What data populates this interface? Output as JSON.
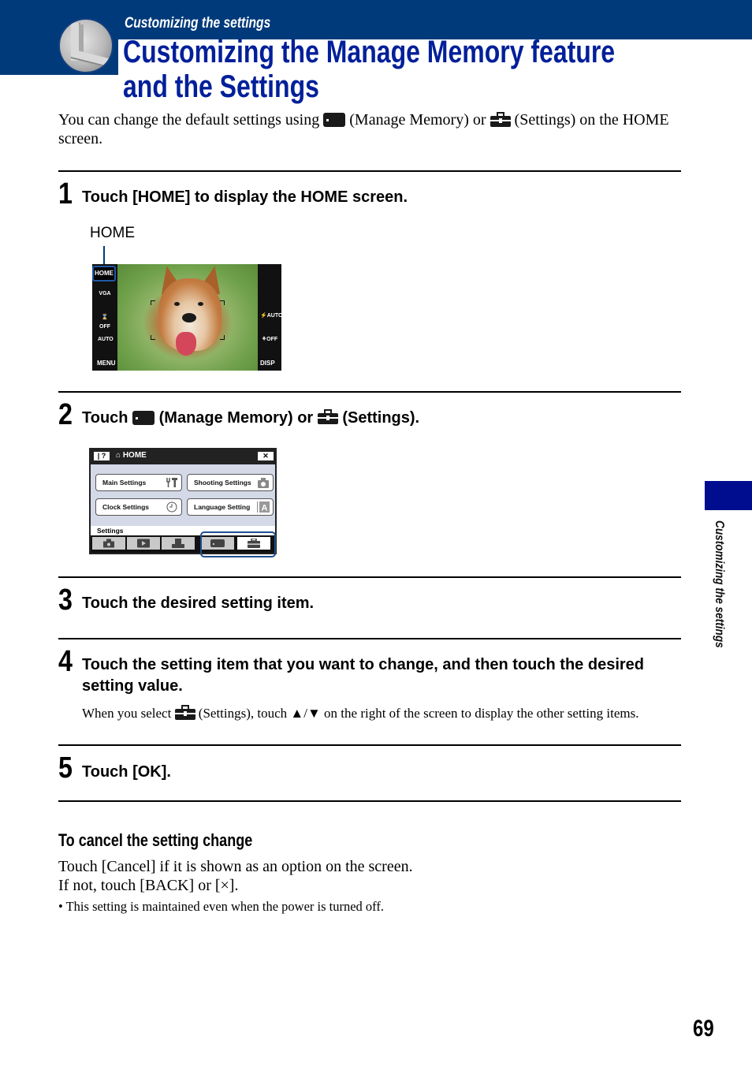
{
  "header": {
    "section_label": "Customizing the settings",
    "title_line1": "Customizing the Manage Memory feature",
    "title_line2": "and the Settings"
  },
  "intro": {
    "part1": "You can change the default settings using ",
    "manage_memory": " (Manage Memory) or ",
    "settings": " (Settings) on the HOME screen."
  },
  "steps": [
    {
      "number": "1",
      "text": "Touch [HOME] to display the HOME screen."
    },
    {
      "number": "2",
      "text_a": "Touch ",
      "text_b": " (Manage Memory) or ",
      "text_c": " (Settings)."
    },
    {
      "number": "3",
      "text": "Touch the desired setting item."
    },
    {
      "number": "4",
      "text": "Touch the setting item that you want to change, and then touch the desired setting value.",
      "note_a": "When you select ",
      "note_b": " (Settings), touch ▲/▼ on the right of the screen to display the other setting items."
    },
    {
      "number": "5",
      "text": "Touch [OK]."
    }
  ],
  "camera_screen_1": {
    "callout": "HOME",
    "left_buttons": [
      "HOME",
      "VGA",
      "⌛OFF",
      "AUTO",
      "MENU"
    ],
    "right_buttons": [
      "⚡AUTO",
      "⚘OFF",
      "DISP"
    ]
  },
  "camera_screen_2": {
    "help": "| ?",
    "title": "⌂ HOME",
    "close": "✕",
    "buttons": [
      "Main Settings",
      "Shooting Settings",
      "Clock Settings",
      "Language Setting"
    ],
    "section": "Settings",
    "tabs": [
      "shooting",
      "playback",
      "print",
      "manage-memory",
      "settings"
    ],
    "selected_tab": "settings"
  },
  "cancel_section": {
    "heading": "To cancel the setting change",
    "line1": "Touch [Cancel] if it is shown as an option on the screen.",
    "line2": "If not, touch [BACK] or [×].",
    "bullet": "•  This setting is maintained even when the power is turned off."
  },
  "side_tab": {
    "label": "Customizing the settings",
    "color": "#000d8f"
  },
  "page_number": "69",
  "colors": {
    "header_band": "#003a7a",
    "title": "#001f99"
  }
}
